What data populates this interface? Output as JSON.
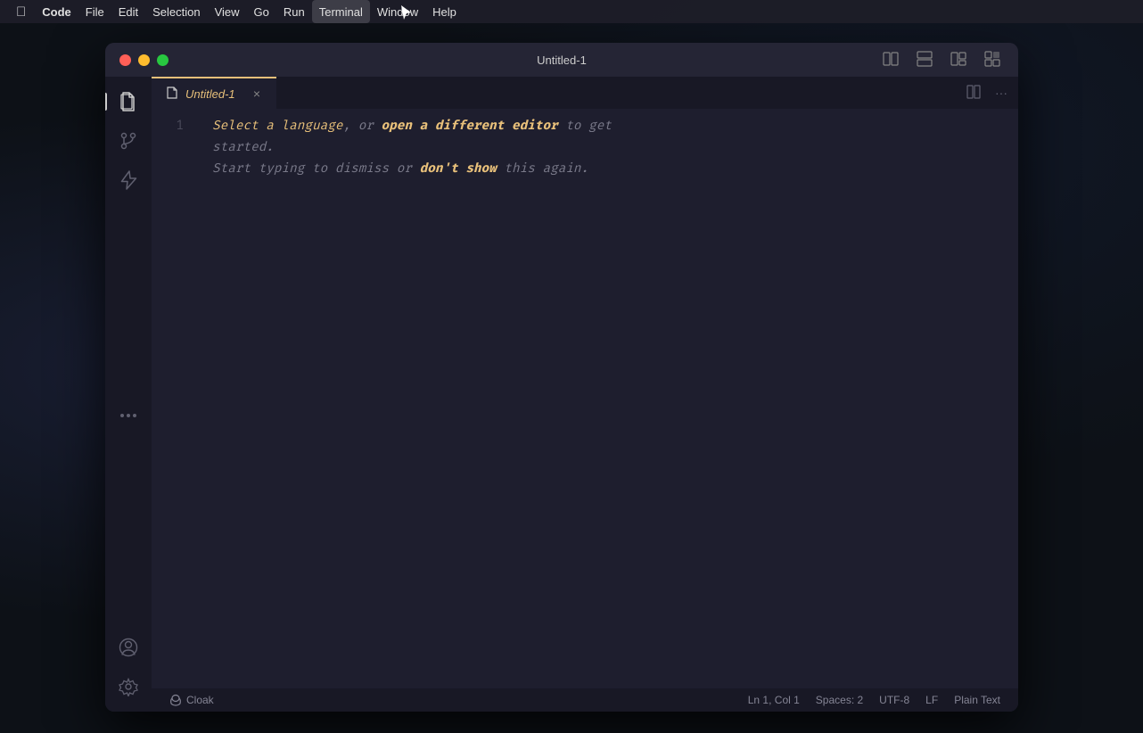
{
  "menubar": {
    "apple": "⌘",
    "items": [
      {
        "label": "Code",
        "active": false,
        "bold": true
      },
      {
        "label": "File",
        "active": false
      },
      {
        "label": "Edit",
        "active": false
      },
      {
        "label": "Selection",
        "active": false
      },
      {
        "label": "View",
        "active": false
      },
      {
        "label": "Go",
        "active": false
      },
      {
        "label": "Run",
        "active": false
      },
      {
        "label": "Terminal",
        "active": true
      },
      {
        "label": "Window",
        "active": false
      },
      {
        "label": "Help",
        "active": false
      }
    ]
  },
  "window": {
    "title": "Untitled-1"
  },
  "tab": {
    "name": "Untitled-1",
    "close_icon": "×"
  },
  "editor": {
    "line_numbers": [
      "1"
    ],
    "line1_part1": "Select a language",
    "line1_part2": ", or ",
    "line1_part3": "open a different editor",
    "line1_part4": " to get",
    "line2": "started.",
    "line3_part1": "Start typing to dismiss or ",
    "line3_part2": "don't show",
    "line3_part3": " this again."
  },
  "status_bar": {
    "cloak_label": "Cloak",
    "position": "Ln 1, Col 1",
    "spaces": "Spaces: 2",
    "encoding": "UTF-8",
    "line_ending": "LF",
    "language": "Plain Text"
  },
  "activity_bar": {
    "items": [
      {
        "name": "files",
        "icon": "files"
      },
      {
        "name": "source-control",
        "icon": "source-control"
      },
      {
        "name": "extensions",
        "icon": "extensions"
      }
    ]
  }
}
